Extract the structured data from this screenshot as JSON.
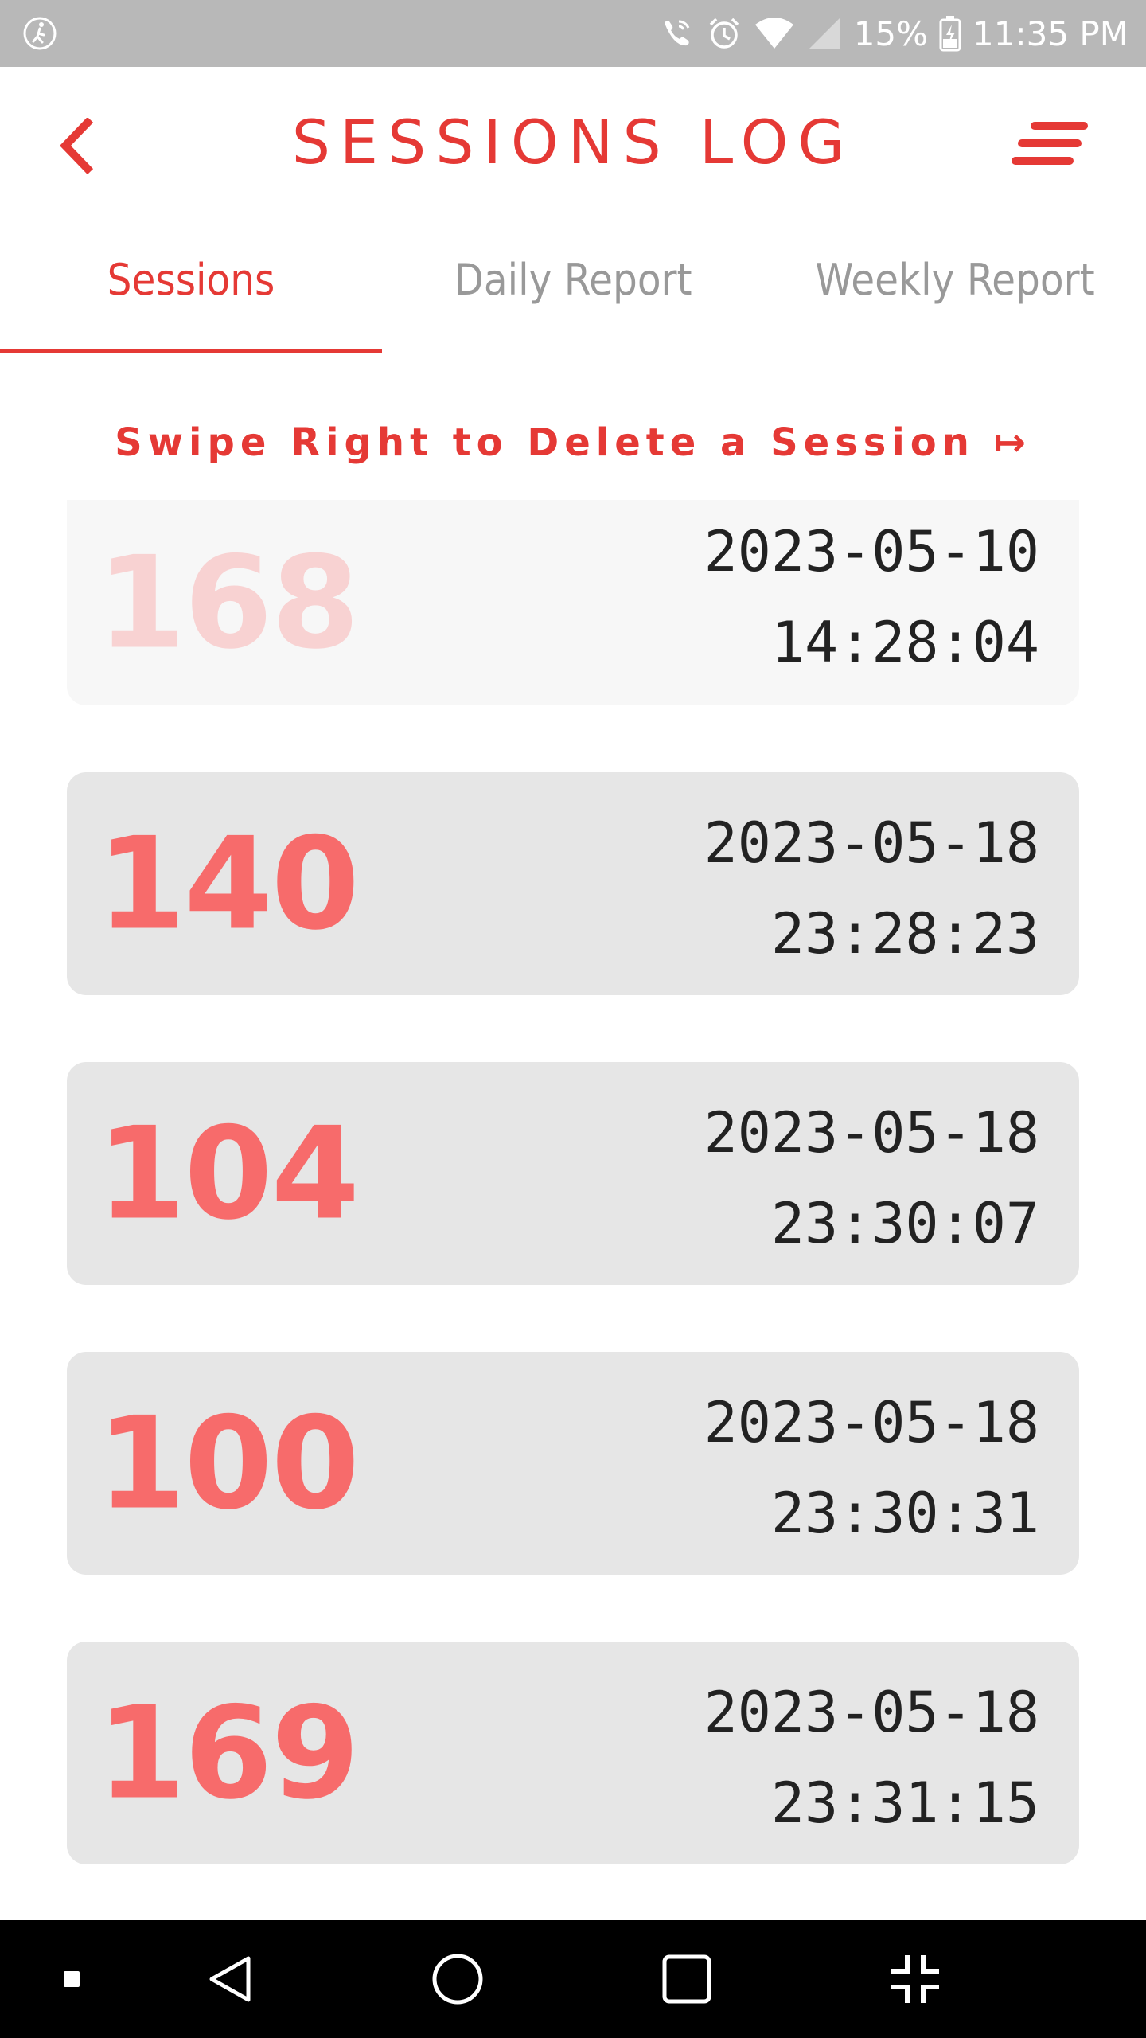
{
  "status_bar": {
    "battery": "15%",
    "time": "11:35 PM"
  },
  "header": {
    "title": "SESSIONS LOG"
  },
  "tabs": [
    {
      "label": "Sessions",
      "active": true
    },
    {
      "label": "Daily Report",
      "active": false
    },
    {
      "label": "Weekly Report",
      "active": false
    }
  ],
  "hint": "Swipe Right to Delete a Session ↦",
  "sessions": [
    {
      "score": "168",
      "date": "2023-05-10",
      "time": "14:28:04"
    },
    {
      "score": "140",
      "date": "2023-05-18",
      "time": "23:28:23"
    },
    {
      "score": "104",
      "date": "2023-05-18",
      "time": "23:30:07"
    },
    {
      "score": "100",
      "date": "2023-05-18",
      "time": "23:30:31"
    },
    {
      "score": "169",
      "date": "2023-05-18",
      "time": "23:31:15"
    }
  ],
  "colors": {
    "accent": "#e53935",
    "score": "#f76b6b",
    "card": "#e6e6e6",
    "status_bar": "#b8b8b8"
  },
  "icons": {
    "back": "chevron-left-icon",
    "menu": "menu-icon"
  }
}
